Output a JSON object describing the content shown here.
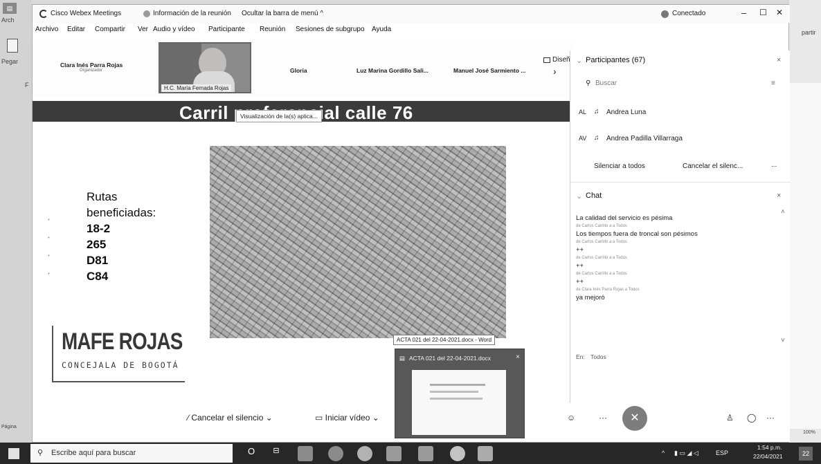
{
  "background_app": {
    "file_tab": "Arch",
    "paste_label": "Pegar",
    "font_hint": "F",
    "status_page": "Página",
    "zoom": "100%",
    "right_fragment": "partir"
  },
  "titlebar": {
    "app_name": "Cisco Webex Meetings",
    "meeting_info": "Información de la reunión",
    "hide_menu": "Ocultar la barra de menú ^",
    "status": "Conectado",
    "minimize": "–",
    "maximize": "☐",
    "close": "✕"
  },
  "menu": [
    "Archivo",
    "Editar",
    "Compartir",
    "Ver",
    "Audio y vídeo",
    "Participante",
    "Reunión",
    "Sesiones de subgrupo",
    "Ayuda"
  ],
  "video_strip": {
    "tiles": [
      {
        "name": "Clara Inés Parra Rojas",
        "sub": "Organizador"
      },
      {
        "name": "Gloria",
        "sub": ""
      },
      {
        "name": "Luz Marina Gordillo Sali...",
        "sub": ""
      },
      {
        "name": "Manuel José Sarmiento ...",
        "sub": ""
      }
    ],
    "active_name": "H.C. María Fernada Rojas",
    "layout_label": "Diseño",
    "next_arrow": "›"
  },
  "slide": {
    "title": "Carril preferencial calle 76",
    "app_tooltip": "Visualización de la(s) aplica...",
    "routes_label_1": "Rutas",
    "routes_label_2": "beneficiadas:",
    "routes": [
      "18-2",
      "265",
      "D81",
      "C84"
    ],
    "logo_main": "MAFE ROJAS",
    "logo_sub": "CONCEJALA DE BOGOTÁ"
  },
  "controls": {
    "mute": "Cancelar el silencio",
    "video": "Iniciar vídeo",
    "leave": "✕"
  },
  "panel": {
    "participants_header": "Participantes (67)",
    "search_placeholder": "Buscar",
    "participants": [
      {
        "initials": "AL",
        "name": "Andrea Luna"
      },
      {
        "initials": "AV",
        "name": "Andrea Padilla Villarraga"
      }
    ],
    "mute_all": "Silenciar a todos",
    "unmute_all": "Cancelar el silenc...",
    "more": "...",
    "chat_header": "Chat",
    "chat": [
      {
        "meta": "",
        "body": "La calidad del servicio es pésima"
      },
      {
        "meta": "de Carlos Carrillo a a Todos",
        "body": "Los tiempos fuera de troncal son pésimos"
      },
      {
        "meta": "de Carlos Carrillo a a Todos",
        "body": "++"
      },
      {
        "meta": "de Carlos Carrillo a a Todos",
        "body": "++"
      },
      {
        "meta": "de Carlos Carrillo a a Todos",
        "body": "++"
      },
      {
        "meta": "de Clara Inés Parra Rojas a Todos",
        "body": "ya mejoró"
      }
    ],
    "chat_to_label": "En:",
    "chat_to_value": "Todos"
  },
  "word_preview": {
    "tooltip": "ACTA 021 del 22-04-2021.docx - Word",
    "title": "ACTA 021 del 22-04-2021.docx"
  },
  "taskbar": {
    "search_placeholder": "Escribe aquí para buscar",
    "lang": "ESP",
    "time": "1:54 p.m.",
    "date": "22/04/2021",
    "notif_count": "22"
  }
}
